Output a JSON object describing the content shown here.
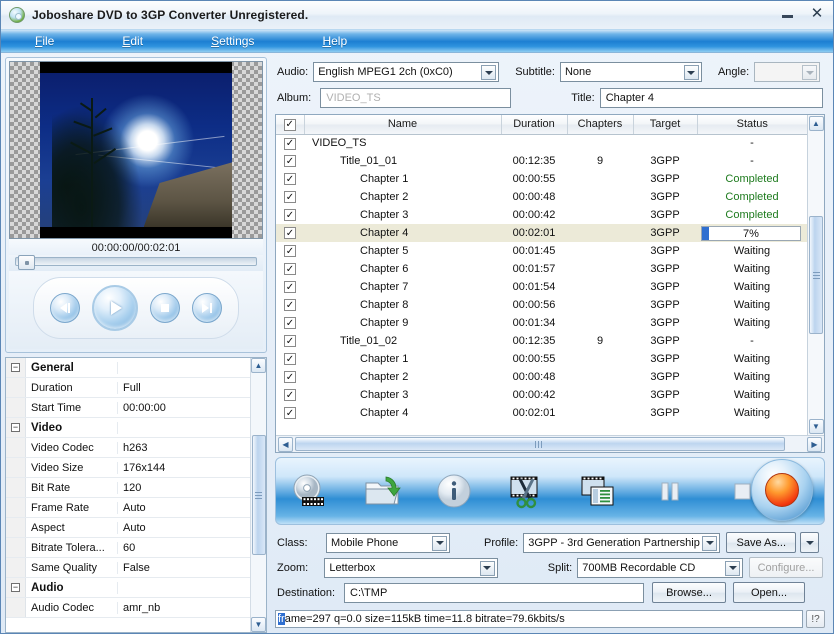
{
  "window": {
    "title": "Joboshare DVD to 3GP Converter Unregistered.",
    "icon": "app-disc-icon",
    "minimize_label": "",
    "close_label": "✕"
  },
  "menu": {
    "items": [
      {
        "label": "File",
        "mnemonic": "F"
      },
      {
        "label": "Edit",
        "mnemonic": "E"
      },
      {
        "label": "Settings",
        "mnemonic": "S"
      },
      {
        "label": "Help",
        "mnemonic": "H"
      }
    ]
  },
  "preview": {
    "time_display": "00:00:00/00:02:01",
    "buttons": {
      "previous": "previous-button",
      "play": "play-button",
      "stop": "stop-button",
      "next": "next-button"
    }
  },
  "properties": {
    "rows": [
      {
        "category": true,
        "name": "General",
        "value": ""
      },
      {
        "category": false,
        "name": "Duration",
        "value": "Full"
      },
      {
        "category": false,
        "name": "Start Time",
        "value": "00:00:00"
      },
      {
        "category": true,
        "name": "Video",
        "value": ""
      },
      {
        "category": false,
        "name": "Video Codec",
        "value": "h263"
      },
      {
        "category": false,
        "name": "Video Size",
        "value": "176x144"
      },
      {
        "category": false,
        "name": "Bit Rate",
        "value": "120"
      },
      {
        "category": false,
        "name": "Frame Rate",
        "value": "Auto"
      },
      {
        "category": false,
        "name": "Aspect",
        "value": "Auto"
      },
      {
        "category": false,
        "name": "Bitrate Tolera...",
        "value": "60"
      },
      {
        "category": false,
        "name": "Same Quality",
        "value": "False"
      },
      {
        "category": true,
        "name": "Audio",
        "value": ""
      },
      {
        "category": false,
        "name": "Audio Codec",
        "value": "amr_nb"
      }
    ]
  },
  "top_form": {
    "audio_label": "Audio:",
    "audio_value": "English MPEG1 2ch (0xC0)",
    "subtitle_label": "Subtitle:",
    "subtitle_value": "None",
    "angle_label": "Angle:",
    "angle_value": "",
    "album_label": "Album:",
    "album_placeholder": "VIDEO_TS",
    "album_value": "",
    "title_label": "Title:",
    "title_value": "Chapter 4"
  },
  "table": {
    "headers": [
      "",
      "Name",
      "Duration",
      "Chapters",
      "Target",
      "Status"
    ],
    "header_checkbox": "✓",
    "rows": [
      {
        "checked": "✓",
        "indent": 0,
        "name": "VIDEO_TS",
        "duration": "",
        "chapters": "",
        "target": "",
        "status": "-",
        "status_class": "st-dash",
        "selected": false
      },
      {
        "checked": "✓",
        "indent": 1,
        "name": "Title_01_01",
        "duration": "00:12:35",
        "chapters": "9",
        "target": "3GPP",
        "status": "-",
        "status_class": "st-dash",
        "selected": false
      },
      {
        "checked": "✓",
        "indent": 2,
        "name": "Chapter 1",
        "duration": "00:00:55",
        "chapters": "",
        "target": "3GPP",
        "status": "Completed",
        "status_class": "st-completed",
        "selected": false
      },
      {
        "checked": "✓",
        "indent": 2,
        "name": "Chapter 2",
        "duration": "00:00:48",
        "chapters": "",
        "target": "3GPP",
        "status": "Completed",
        "status_class": "st-completed",
        "selected": false
      },
      {
        "checked": "✓",
        "indent": 2,
        "name": "Chapter 3",
        "duration": "00:00:42",
        "chapters": "",
        "target": "3GPP",
        "status": "Completed",
        "status_class": "st-completed",
        "selected": false
      },
      {
        "checked": "✓",
        "indent": 2,
        "name": "Chapter 4",
        "duration": "00:02:01",
        "chapters": "",
        "target": "3GPP",
        "status": "7%",
        "status_class": "progress",
        "progress": 7,
        "selected": true
      },
      {
        "checked": "✓",
        "indent": 2,
        "name": "Chapter 5",
        "duration": "00:01:45",
        "chapters": "",
        "target": "3GPP",
        "status": "Waiting",
        "status_class": "st-waiting",
        "selected": false
      },
      {
        "checked": "✓",
        "indent": 2,
        "name": "Chapter 6",
        "duration": "00:01:57",
        "chapters": "",
        "target": "3GPP",
        "status": "Waiting",
        "status_class": "st-waiting",
        "selected": false
      },
      {
        "checked": "✓",
        "indent": 2,
        "name": "Chapter 7",
        "duration": "00:01:54",
        "chapters": "",
        "target": "3GPP",
        "status": "Waiting",
        "status_class": "st-waiting",
        "selected": false
      },
      {
        "checked": "✓",
        "indent": 2,
        "name": "Chapter 8",
        "duration": "00:00:56",
        "chapters": "",
        "target": "3GPP",
        "status": "Waiting",
        "status_class": "st-waiting",
        "selected": false
      },
      {
        "checked": "✓",
        "indent": 2,
        "name": "Chapter 9",
        "duration": "00:01:34",
        "chapters": "",
        "target": "3GPP",
        "status": "Waiting",
        "status_class": "st-waiting",
        "selected": false
      },
      {
        "checked": "✓",
        "indent": 1,
        "name": "Title_01_02",
        "duration": "00:12:35",
        "chapters": "9",
        "target": "3GPP",
        "status": "-",
        "status_class": "st-dash",
        "selected": false
      },
      {
        "checked": "✓",
        "indent": 2,
        "name": "Chapter 1",
        "duration": "00:00:55",
        "chapters": "",
        "target": "3GPP",
        "status": "Waiting",
        "status_class": "st-waiting",
        "selected": false
      },
      {
        "checked": "✓",
        "indent": 2,
        "name": "Chapter 2",
        "duration": "00:00:48",
        "chapters": "",
        "target": "3GPP",
        "status": "Waiting",
        "status_class": "st-waiting",
        "selected": false
      },
      {
        "checked": "✓",
        "indent": 2,
        "name": "Chapter 3",
        "duration": "00:00:42",
        "chapters": "",
        "target": "3GPP",
        "status": "Waiting",
        "status_class": "st-waiting",
        "selected": false
      },
      {
        "checked": "✓",
        "indent": 2,
        "name": "Chapter 4",
        "duration": "00:02:01",
        "chapters": "",
        "target": "3GPP",
        "status": "Waiting",
        "status_class": "st-waiting",
        "selected": false
      }
    ]
  },
  "toolbar": {
    "buttons": [
      {
        "name": "load-dvd-icon"
      },
      {
        "name": "open-folder-icon"
      },
      {
        "name": "info-icon"
      },
      {
        "name": "trim-scissors-icon"
      },
      {
        "name": "merge-icon"
      },
      {
        "name": "pause-icon"
      },
      {
        "name": "stop-icon"
      }
    ],
    "record_button": "start-encode-button"
  },
  "settings": {
    "class_label": "Class:",
    "class_value": "Mobile Phone",
    "profile_label": "Profile:",
    "profile_value": "3GPP - 3rd Generation Partnership",
    "save_as_label": "Save As...",
    "zoom_label": "Zoom:",
    "zoom_value": "Letterbox",
    "split_label": "Split:",
    "split_value": "700MB Recordable CD",
    "configure_label": "Configure...",
    "destination_label": "Destination:",
    "destination_value": "C:\\TMP",
    "browse_label": "Browse...",
    "open_label": "Open..."
  },
  "statusbar": {
    "text_highlight": "fr",
    "text": "ame=297 q=0.0 size=115kB time=11.8 bitrate=79.6kbits/s",
    "help_button": "!?"
  },
  "colors": {
    "accent_blue": "#1d7fd2",
    "progress_blue": "#2f6fd0",
    "completed_green": "#1e7b1e",
    "selection": "#ecead8"
  }
}
